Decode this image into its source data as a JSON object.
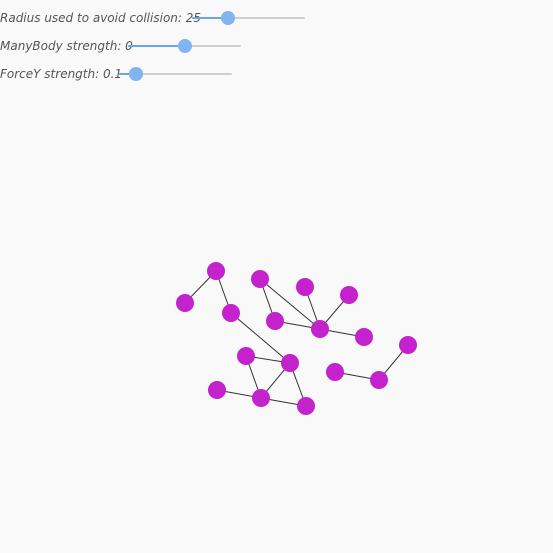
{
  "controls": {
    "collision": {
      "label": "Radius used to avoid collision: 25",
      "fraction": 0.32
    },
    "manybody": {
      "label": "ManyBody strength: 0",
      "fraction": 0.5
    },
    "forcey": {
      "label": "ForceY strength: 0.1",
      "fraction": 0.15
    }
  },
  "colors": {
    "node": "#c322cc",
    "link": "#333333",
    "slider_track": "#cfcfcf",
    "slider_fill": "#6aa3e8",
    "slider_thumb": "#82b4f2"
  },
  "graph": {
    "node_count": 19
  }
}
